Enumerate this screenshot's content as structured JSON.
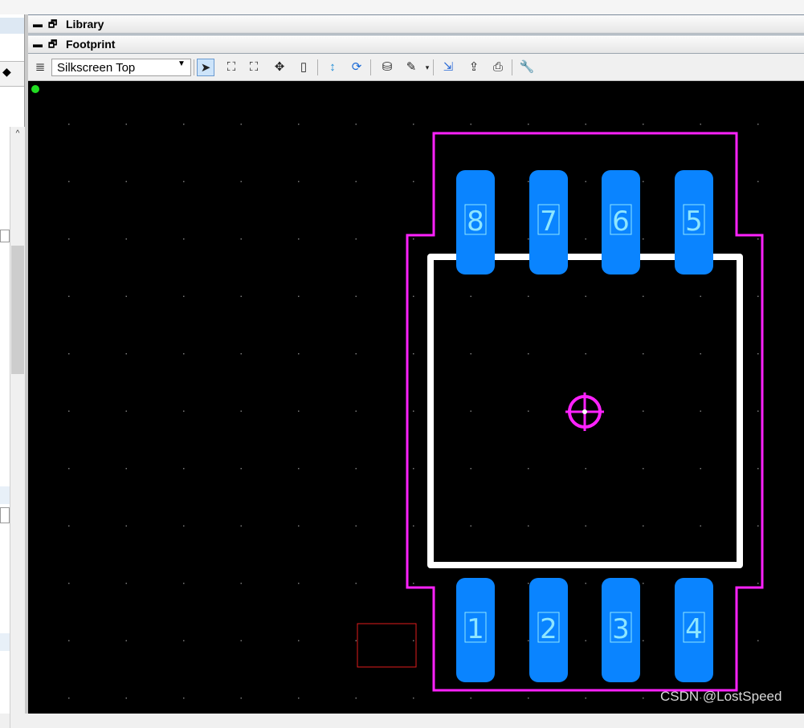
{
  "panels": {
    "library_title": "Library",
    "footprint_title": "Footprint"
  },
  "toolbar": {
    "layer_selected": "Silkscreen Top"
  },
  "footprint": {
    "pads_top": [
      "8",
      "7",
      "6",
      "5"
    ],
    "pads_bottom": [
      "1",
      "2",
      "3",
      "4"
    ],
    "colors": {
      "pad": "#0a84ff",
      "pad_label": "#8ee6ff",
      "outline": "#ff22ff",
      "silkscreen": "#ffffff",
      "edge_stripe": "#ffd400",
      "selection_box": "#e01c1c",
      "grid_dot": "#7a7a7a"
    }
  },
  "watermark": "CSDN @LostSpeed"
}
